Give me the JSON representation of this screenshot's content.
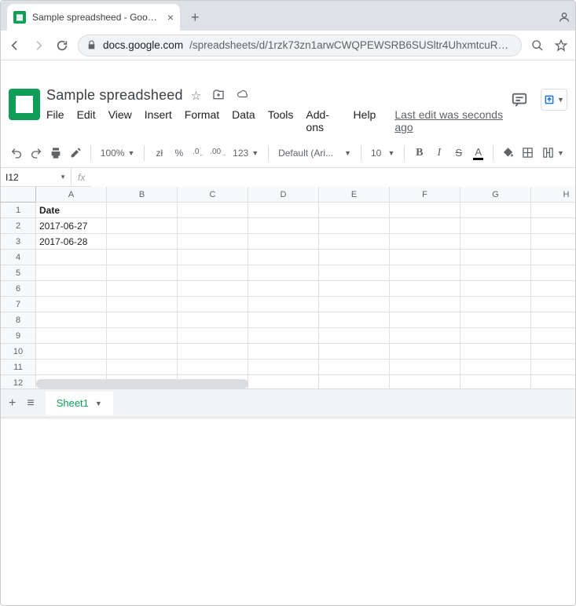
{
  "browser": {
    "tab_title": "Sample spreadsheed - Google Sh",
    "url_host": "docs.google.com",
    "url_path": "/spreadsheets/d/1rzk73zn1arwCWQPEWSRB6SUSltr4UhxmtcuRaDvk..."
  },
  "doc": {
    "title": "Sample spreadsheed",
    "last_edit": "Last edit was seconds ago",
    "menu": [
      "File",
      "Edit",
      "View",
      "Insert",
      "Format",
      "Data",
      "Tools",
      "Add-ons",
      "Help"
    ]
  },
  "toolbar": {
    "zoom": "100%",
    "currency": "zł",
    "percent": "%",
    "dec_less": ".0",
    "dec_more": ".00",
    "num_format": "123",
    "font": "Default (Ari...",
    "font_size": "10"
  },
  "fx": {
    "cell_ref": "I12",
    "formula": ""
  },
  "columns": [
    "A",
    "B",
    "C",
    "D",
    "E",
    "F",
    "G",
    "H"
  ],
  "rows": [
    "1",
    "2",
    "3",
    "4",
    "5",
    "6",
    "7",
    "8",
    "9",
    "10",
    "11",
    "12"
  ],
  "cells": {
    "A1": "Date",
    "A2": "2017-06-27",
    "A3": "2017-06-28"
  },
  "sheet": {
    "name": "Sheet1"
  }
}
